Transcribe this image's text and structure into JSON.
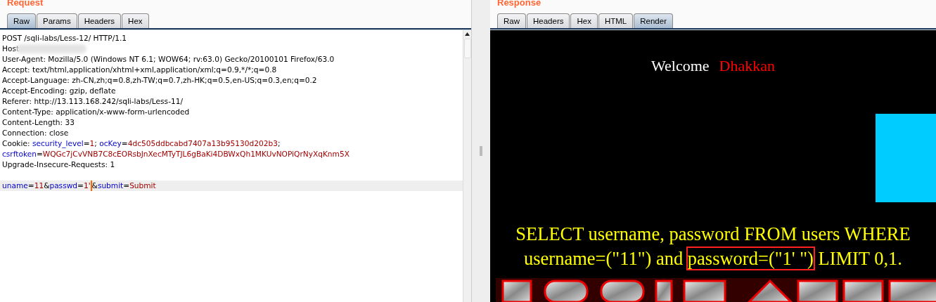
{
  "request": {
    "title": "Request",
    "tabs": [
      {
        "label": "Raw",
        "selected": true
      },
      {
        "label": "Params",
        "selected": false
      },
      {
        "label": "Headers",
        "selected": false
      },
      {
        "label": "Hex",
        "selected": false
      }
    ],
    "lines": [
      {
        "segments": [
          {
            "text": "POST /sqli-labs/Less-12/ HTTP/1.1",
            "kind": "plain"
          }
        ]
      },
      {
        "segments": [
          {
            "text": "Host",
            "kind": "plain"
          }
        ],
        "blurred": true
      },
      {
        "segments": [
          {
            "text": "User-Agent: Mozilla/5.0 (Windows NT 6.1; WOW64; rv:63.0) Gecko/20100101 Firefox/63.0",
            "kind": "plain"
          }
        ]
      },
      {
        "segments": [
          {
            "text": "Accept: text/html,application/xhtml+xml,application/xml;q=0.9,*/*;q=0.8",
            "kind": "plain"
          }
        ]
      },
      {
        "segments": [
          {
            "text": "Accept-Language: zh-CN,zh;q=0.8,zh-TW;q=0.7,zh-HK;q=0.5,en-US;q=0.3,en;q=0.2",
            "kind": "plain"
          }
        ]
      },
      {
        "segments": [
          {
            "text": "Accept-Encoding: gzip, deflate",
            "kind": "plain"
          }
        ]
      },
      {
        "segments": [
          {
            "text": "Referer: http://13.113.168.242/sqli-labs/Less-11/",
            "kind": "plain"
          }
        ]
      },
      {
        "segments": [
          {
            "text": "Content-Type: application/x-www-form-urlencoded",
            "kind": "plain"
          }
        ]
      },
      {
        "segments": [
          {
            "text": "Content-Length: 33",
            "kind": "plain"
          }
        ]
      },
      {
        "segments": [
          {
            "text": "Connection: close",
            "kind": "plain"
          }
        ]
      },
      {
        "segments": [
          {
            "text": "Cookie: ",
            "kind": "plain"
          },
          {
            "text": "security_level",
            "kind": "name"
          },
          {
            "text": "=",
            "kind": "plain"
          },
          {
            "text": "1",
            "kind": "value"
          },
          {
            "text": "; ",
            "kind": "plain"
          },
          {
            "text": "ocKey",
            "kind": "name"
          },
          {
            "text": "=",
            "kind": "plain"
          },
          {
            "text": "4dc505ddbcabd7407a13b95130d202b3",
            "kind": "value"
          },
          {
            "text": ";",
            "kind": "plain"
          }
        ]
      },
      {
        "segments": [
          {
            "text": "csrftoken",
            "kind": "name"
          },
          {
            "text": "=",
            "kind": "plain"
          },
          {
            "text": "WQGc7jCvVNB7C8cEORsbJnXecMTyTJL6gBaKi4DBWxQh1MKUvNOPiQrNyXqKnm5X",
            "kind": "value"
          }
        ]
      },
      {
        "segments": [
          {
            "text": "Upgrade-Insecure-Requests: 1",
            "kind": "plain"
          }
        ]
      },
      {
        "kind": "blank"
      },
      {
        "segments": [
          {
            "text": "uname",
            "kind": "name"
          },
          {
            "text": "=",
            "kind": "plain"
          },
          {
            "text": "11",
            "kind": "value"
          },
          {
            "text": "&",
            "kind": "plain"
          },
          {
            "text": "passwd",
            "kind": "name"
          },
          {
            "text": "=",
            "kind": "plain"
          },
          {
            "text": "1'",
            "kind": "value"
          },
          {
            "text": "&",
            "kind": "plain",
            "cursor": true
          },
          {
            "text": "submit",
            "kind": "name"
          },
          {
            "text": "=",
            "kind": "plain"
          },
          {
            "text": "Submit",
            "kind": "value"
          }
        ],
        "highlighted": true
      }
    ]
  },
  "response": {
    "title": "Response",
    "tabs": [
      {
        "label": "Raw",
        "selected": false
      },
      {
        "label": "Headers",
        "selected": false
      },
      {
        "label": "Hex",
        "selected": false
      },
      {
        "label": "HTML",
        "selected": false
      },
      {
        "label": "Render",
        "selected": true
      }
    ],
    "welcome": {
      "label": "Welcome",
      "name": "Dhakkan"
    },
    "query_lines": [
      {
        "segments": [
          {
            "text": "SELECT username, password FROM users WHERE",
            "boxed": false
          }
        ]
      },
      {
        "segments": [
          {
            "text": "username=(\"11\") and ",
            "boxed": false
          },
          {
            "text": "password=(\"1' \")",
            "boxed": true
          },
          {
            "text": " LIMIT 0,1.",
            "boxed": false
          }
        ]
      }
    ]
  }
}
